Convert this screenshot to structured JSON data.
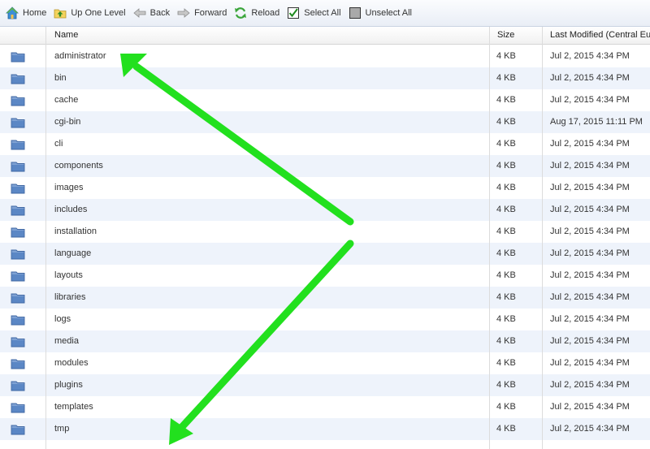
{
  "toolbar": {
    "home_label": "Home",
    "up_label": "Up One Level",
    "back_label": "Back",
    "forward_label": "Forward",
    "reload_label": "Reload",
    "select_all_label": "Select All",
    "unselect_all_label": "Unselect All"
  },
  "table": {
    "columns": {
      "name": "Name",
      "size": "Size",
      "modified": "Last Modified (Central Eu"
    },
    "rows": [
      {
        "name": "administrator",
        "size": "4 KB",
        "modified": "Jul 2, 2015 4:34 PM"
      },
      {
        "name": "bin",
        "size": "4 KB",
        "modified": "Jul 2, 2015 4:34 PM"
      },
      {
        "name": "cache",
        "size": "4 KB",
        "modified": "Jul 2, 2015 4:34 PM"
      },
      {
        "name": "cgi-bin",
        "size": "4 KB",
        "modified": "Aug 17, 2015 11:11 PM"
      },
      {
        "name": "cli",
        "size": "4 KB",
        "modified": "Jul 2, 2015 4:34 PM"
      },
      {
        "name": "components",
        "size": "4 KB",
        "modified": "Jul 2, 2015 4:34 PM"
      },
      {
        "name": "images",
        "size": "4 KB",
        "modified": "Jul 2, 2015 4:34 PM"
      },
      {
        "name": "includes",
        "size": "4 KB",
        "modified": "Jul 2, 2015 4:34 PM"
      },
      {
        "name": "installation",
        "size": "4 KB",
        "modified": "Jul 2, 2015 4:34 PM"
      },
      {
        "name": "language",
        "size": "4 KB",
        "modified": "Jul 2, 2015 4:34 PM"
      },
      {
        "name": "layouts",
        "size": "4 KB",
        "modified": "Jul 2, 2015 4:34 PM"
      },
      {
        "name": "libraries",
        "size": "4 KB",
        "modified": "Jul 2, 2015 4:34 PM"
      },
      {
        "name": "logs",
        "size": "4 KB",
        "modified": "Jul 2, 2015 4:34 PM"
      },
      {
        "name": "media",
        "size": "4 KB",
        "modified": "Jul 2, 2015 4:34 PM"
      },
      {
        "name": "modules",
        "size": "4 KB",
        "modified": "Jul 2, 2015 4:34 PM"
      },
      {
        "name": "plugins",
        "size": "4 KB",
        "modified": "Jul 2, 2015 4:34 PM"
      },
      {
        "name": "templates",
        "size": "4 KB",
        "modified": "Jul 2, 2015 4:34 PM"
      },
      {
        "name": "tmp",
        "size": "4 KB",
        "modified": "Jul 2, 2015 4:34 PM"
      }
    ]
  },
  "colors": {
    "folder": "#5b87c5",
    "row_alt": "#eef3fb",
    "arrow": "#22e01e"
  }
}
